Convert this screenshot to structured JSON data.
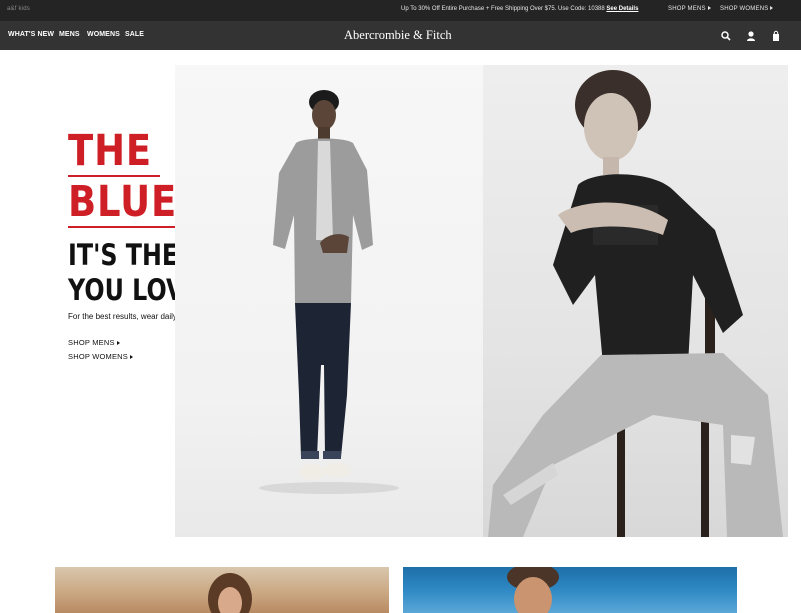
{
  "promo_bar": {
    "kids_link": "a&f kids",
    "promo_text": "Up To 30% Off Entire Purchase + Free Shipping Over $75. Use Code: 10388",
    "promo_details": "See Details",
    "shop_mens": "SHOP MENS",
    "shop_womens": "SHOP WOMENS"
  },
  "nav": {
    "items": [
      "WHAT'S NEW",
      "MENS",
      "WOMENS",
      "SALE"
    ],
    "logo": "Abercrombie & Fitch",
    "icons": [
      "search-icon",
      "account-icon",
      "shopping-bag-icon"
    ]
  },
  "hero": {
    "title_line1": "THE",
    "title_line2": "BLUES",
    "subtitle_line1": "IT'S THE DENIM",
    "subtitle_line2": "YOU LOVE.",
    "tagline": "For the best results, wear daily.",
    "links": [
      "SHOP MENS",
      "SHOP WOMENS"
    ]
  },
  "colors": {
    "promo_bar": "#242424",
    "nav_bar": "#333333",
    "accent_red": "#cf1f26"
  }
}
